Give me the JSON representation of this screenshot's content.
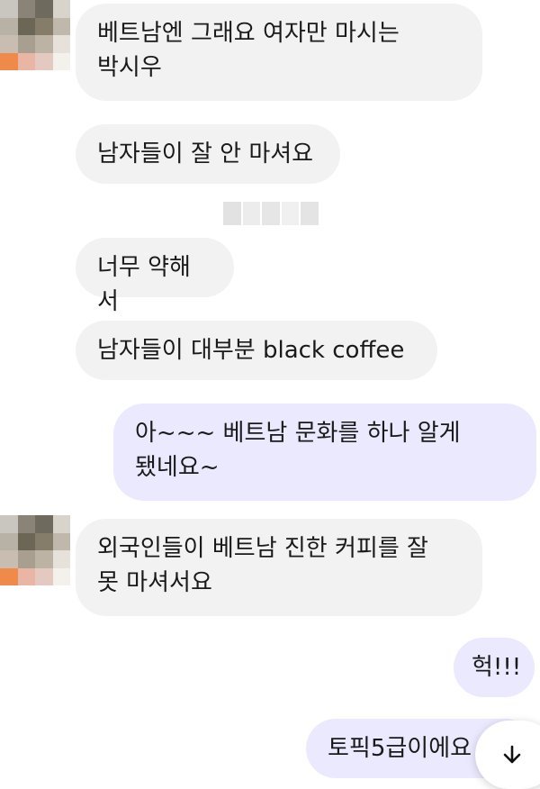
{
  "messages": [
    {
      "text": "베트남엔 그래요 여자만 마시는\n박시우"
    },
    {
      "text": "남자들이 잘 안 마셔요"
    },
    {
      "text": "너무 약해서"
    },
    {
      "text": "남자들이 대부분 black coffee"
    },
    {
      "text": "아~~~ 베트남 문화를 하나 알게\n됐네요~"
    },
    {
      "text": "외국인들이 베트남 진한 커피를 잘\n못 마셔서요"
    },
    {
      "text": "헉!!!"
    },
    {
      "text": "토픽5급이에요"
    }
  ],
  "icons": {
    "scroll_down": "arrow-down-icon"
  },
  "colors": {
    "incoming_bubble": "#f2f2f2",
    "outgoing_bubble": "#ebe9fd"
  }
}
